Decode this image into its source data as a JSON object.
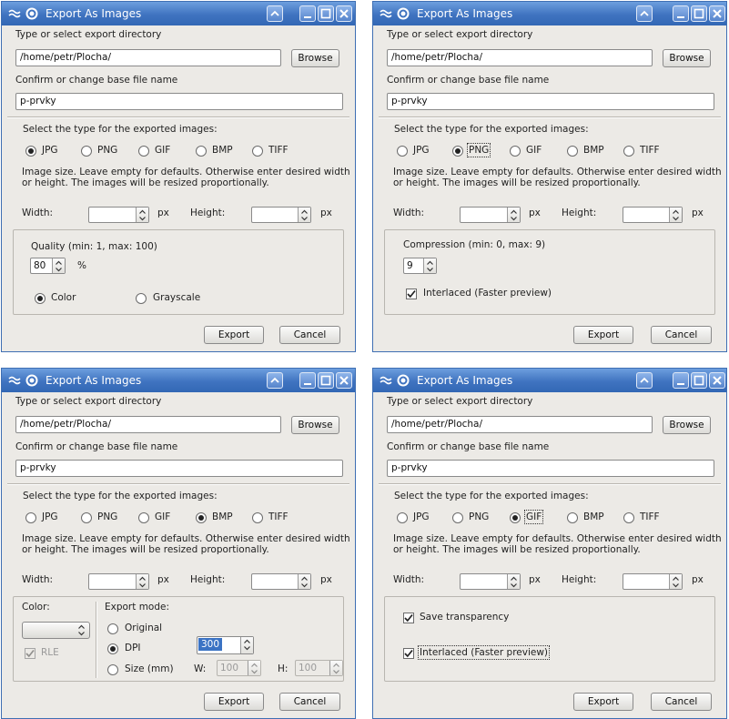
{
  "dialog": {
    "title": "Export As Images",
    "dir_label": "Type or select export directory",
    "dir_value": "/home/petr/Plocha/",
    "browse_label": "Browse",
    "name_label": "Confirm or change base file name",
    "name_value": "p-prvky",
    "type_label": "Select the type for the exported images:",
    "formats": [
      "JPG",
      "PNG",
      "GIF",
      "BMP",
      "TIFF"
    ],
    "size_hint_line1": "Image size. Leave empty for defaults. Otherwise enter desired width",
    "size_hint_line2": "or height. The images will be resized proportionally.",
    "width_label": "Width:",
    "height_label": "Height:",
    "px_unit": "px",
    "export_label": "Export",
    "cancel_label": "Cancel"
  },
  "dialogs": [
    {
      "selected_format": "JPG",
      "jpg": {
        "quality_label": "Quality (min: 1, max: 100)",
        "quality_value": "80",
        "unit": "%",
        "color_label": "Color",
        "grayscale_label": "Grayscale",
        "selected_mode": "Color"
      }
    },
    {
      "selected_format": "PNG",
      "png": {
        "compression_label": "Compression (min: 0, max: 9)",
        "compression_value": "9",
        "interlaced_label": "Interlaced (Faster preview)",
        "interlaced_checked": true
      }
    },
    {
      "selected_format": "BMP",
      "bmp": {
        "color_label": "Color:",
        "rle_label": "RLE",
        "rle_checked": true,
        "export_mode_label": "Export mode:",
        "original_label": "Original",
        "dpi_label": "DPI",
        "size_label": "Size (mm)",
        "selected_mode": "DPI",
        "dpi_value": "300",
        "w_label": "W:",
        "w_value": "100",
        "h_label": "H:",
        "h_value": "100"
      }
    },
    {
      "selected_format": "GIF",
      "gif": {
        "transparency_label": "Save transparency",
        "transparency_checked": true,
        "interlaced_label": "Interlaced (Faster preview)",
        "interlaced_checked": true
      }
    }
  ],
  "colors": {
    "titlebar": "#3f73c0",
    "window_bg": "#eceae6",
    "selection": "#3b73c4"
  }
}
